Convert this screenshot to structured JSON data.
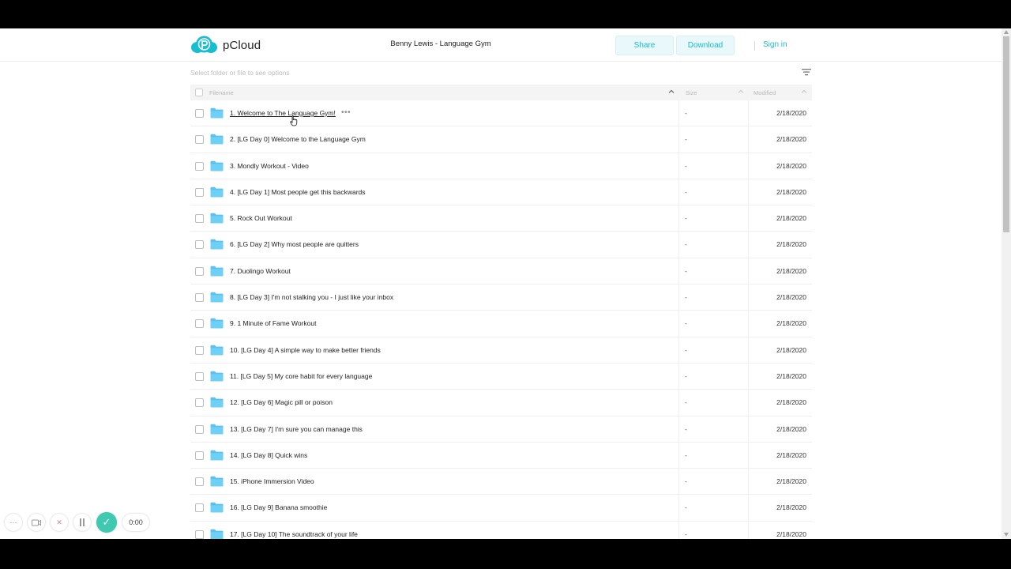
{
  "app": {
    "brand": "pCloud",
    "folder_title": "Benny Lewis - Language Gym",
    "brand_color": "#17bed0"
  },
  "toolbar": {
    "share_label": "Share",
    "download_label": "Download",
    "signin_label": "Sign in"
  },
  "hint": "Select folder or file to see options",
  "columns": {
    "name": "Filename",
    "size": "Size",
    "modified": "Modified"
  },
  "rows": [
    {
      "name": "1. Welcome to The Language Gym!",
      "size": "-",
      "modified": "2/18/2020"
    },
    {
      "name": "2. [LG Day 0] Welcome to the Language Gym",
      "size": "-",
      "modified": "2/18/2020"
    },
    {
      "name": "3. Mondly Workout - Video",
      "size": "-",
      "modified": "2/18/2020"
    },
    {
      "name": "4. [LG Day 1] Most people get this backwards",
      "size": "-",
      "modified": "2/18/2020"
    },
    {
      "name": "5. Rock Out Workout",
      "size": "-",
      "modified": "2/18/2020"
    },
    {
      "name": "6. [LG Day 2] Why most people are quitters",
      "size": "-",
      "modified": "2/18/2020"
    },
    {
      "name": "7. Duolingo Workout",
      "size": "-",
      "modified": "2/18/2020"
    },
    {
      "name": "8. [LG Day 3] I'm not stalking you - I just like your inbox",
      "size": "-",
      "modified": "2/18/2020"
    },
    {
      "name": "9. 1 Minute of Fame Workout",
      "size": "-",
      "modified": "2/18/2020"
    },
    {
      "name": "10. [LG Day 4] A simple way to make better friends",
      "size": "-",
      "modified": "2/18/2020"
    },
    {
      "name": "11. [LG Day 5] My core habit for every language",
      "size": "-",
      "modified": "2/18/2020"
    },
    {
      "name": "12. [LG Day 6] Magic pill or poison",
      "size": "-",
      "modified": "2/18/2020"
    },
    {
      "name": "13. [LG Day 7] I'm sure you can manage this",
      "size": "-",
      "modified": "2/18/2020"
    },
    {
      "name": "14. [LG Day 8] Quick wins",
      "size": "-",
      "modified": "2/18/2020"
    },
    {
      "name": "15. iPhone Immersion Video",
      "size": "-",
      "modified": "2/18/2020"
    },
    {
      "name": "16. [LG Day 9] Banana smoothie",
      "size": "-",
      "modified": "2/18/2020"
    },
    {
      "name": "17. [LG Day 10] The soundtrack of your life",
      "size": "-",
      "modified": "2/18/2020"
    }
  ],
  "recorder": {
    "time": "0:00",
    "more_icon": "ellipsis-icon",
    "camera_icon": "camera-icon",
    "cancel_icon": "close-icon",
    "pause_icon": "pause-icon",
    "done_icon": "check-icon"
  }
}
